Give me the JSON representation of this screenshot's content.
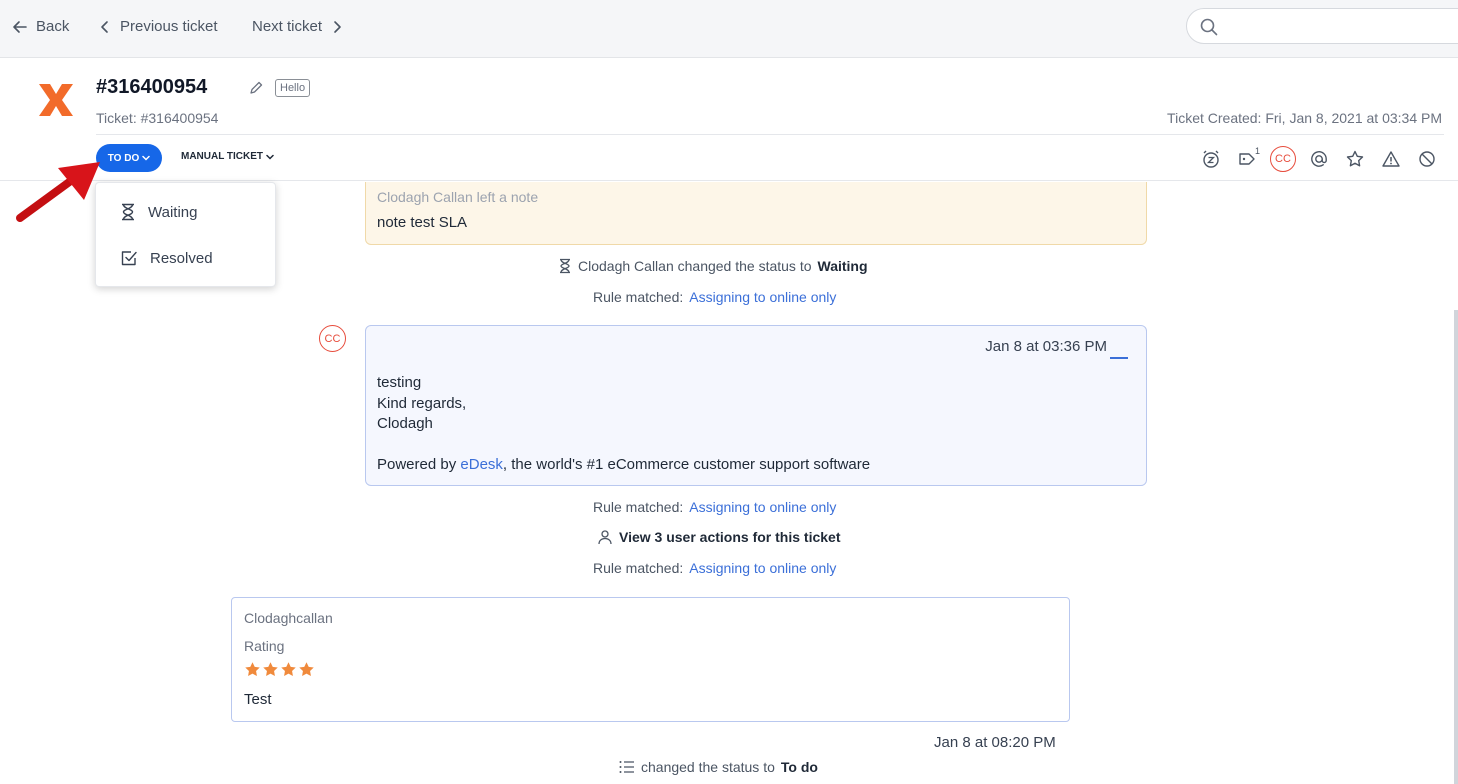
{
  "nav": {
    "back": "Back",
    "previous": "Previous ticket",
    "next": "Next ticket",
    "search_placeholder": ""
  },
  "ticket": {
    "title": "#316400954",
    "badge": "Hello",
    "subtitle": "Ticket: #316400954",
    "created": "Ticket Created: Fri, Jan 8, 2021 at 03:34 PM",
    "status": "TO DO",
    "type": "MANUAL TICKET",
    "tag_count": "1",
    "cc_initials": "CC"
  },
  "status_menu": {
    "items": [
      {
        "label": "Waiting",
        "icon": "hourglass-icon"
      },
      {
        "label": "Resolved",
        "icon": "checkbox-icon"
      }
    ]
  },
  "timeline": {
    "note_author": "Clodagh Callan left a note",
    "note_body": "note test SLA",
    "status_change": {
      "prefix": "Clodagh Callan changed the status to",
      "value": "Waiting"
    },
    "rule_prefix": "Rule matched:",
    "rule_link": "Assigning to online only",
    "message": {
      "avatar": "CC",
      "time": "Jan 8 at 03:36 PM",
      "lines": [
        "testing",
        "Kind regards,",
        "Clodagh"
      ],
      "powered_prefix": "Powered by",
      "powered_link": "eDesk",
      "powered_suffix": ", the world's #1 eCommerce customer support software"
    },
    "user_actions": "View 3 user actions for this ticket",
    "rating": {
      "name": "Clodaghcallan",
      "label": "Rating",
      "stars": 4,
      "text": "Test",
      "time": "Jan 8 at 08:20 PM"
    },
    "final_status": {
      "prefix": "changed the status to",
      "value": "To do"
    }
  },
  "colors": {
    "accent": "#1667e8",
    "link": "#3b6fd8",
    "star": "#f08a3c",
    "cc": "#e74c3c",
    "note_bg": "#fdf6e8"
  }
}
